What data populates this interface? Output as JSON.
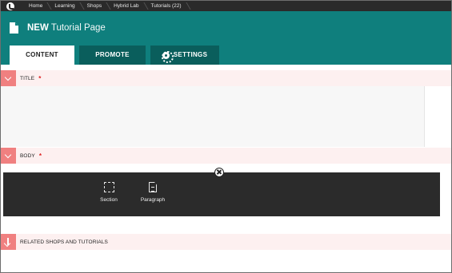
{
  "breadcrumb": [
    "Home",
    "Learning",
    "Shops",
    "Hybrid Lab",
    "Tutorials (22)"
  ],
  "header": {
    "new_label": "NEW",
    "title": "Tutorial Page"
  },
  "tabs": [
    {
      "label": "CONTENT",
      "active": true
    },
    {
      "label": "PROMOTE",
      "active": false
    },
    {
      "label": "SETTINGS",
      "active": false,
      "icon": "gear-icon"
    }
  ],
  "sections": {
    "title": {
      "label": "TITLE",
      "required_mark": "*"
    },
    "body": {
      "label": "BODY",
      "required_mark": "*"
    },
    "related": {
      "label": "RELATED SHOPS AND TUTORIALS"
    }
  },
  "insert_menu": {
    "items": [
      {
        "label": "Section",
        "icon": "section-icon"
      },
      {
        "label": "Paragraph",
        "icon": "paragraph-icon"
      }
    ]
  },
  "colors": {
    "header_bg": "#0f7f7d",
    "tab_inactive": "#0a5e5c",
    "section_toggle": "#f08080",
    "section_bg": "#fdf0f0",
    "insert_bar_bg": "#2b2b2b"
  }
}
